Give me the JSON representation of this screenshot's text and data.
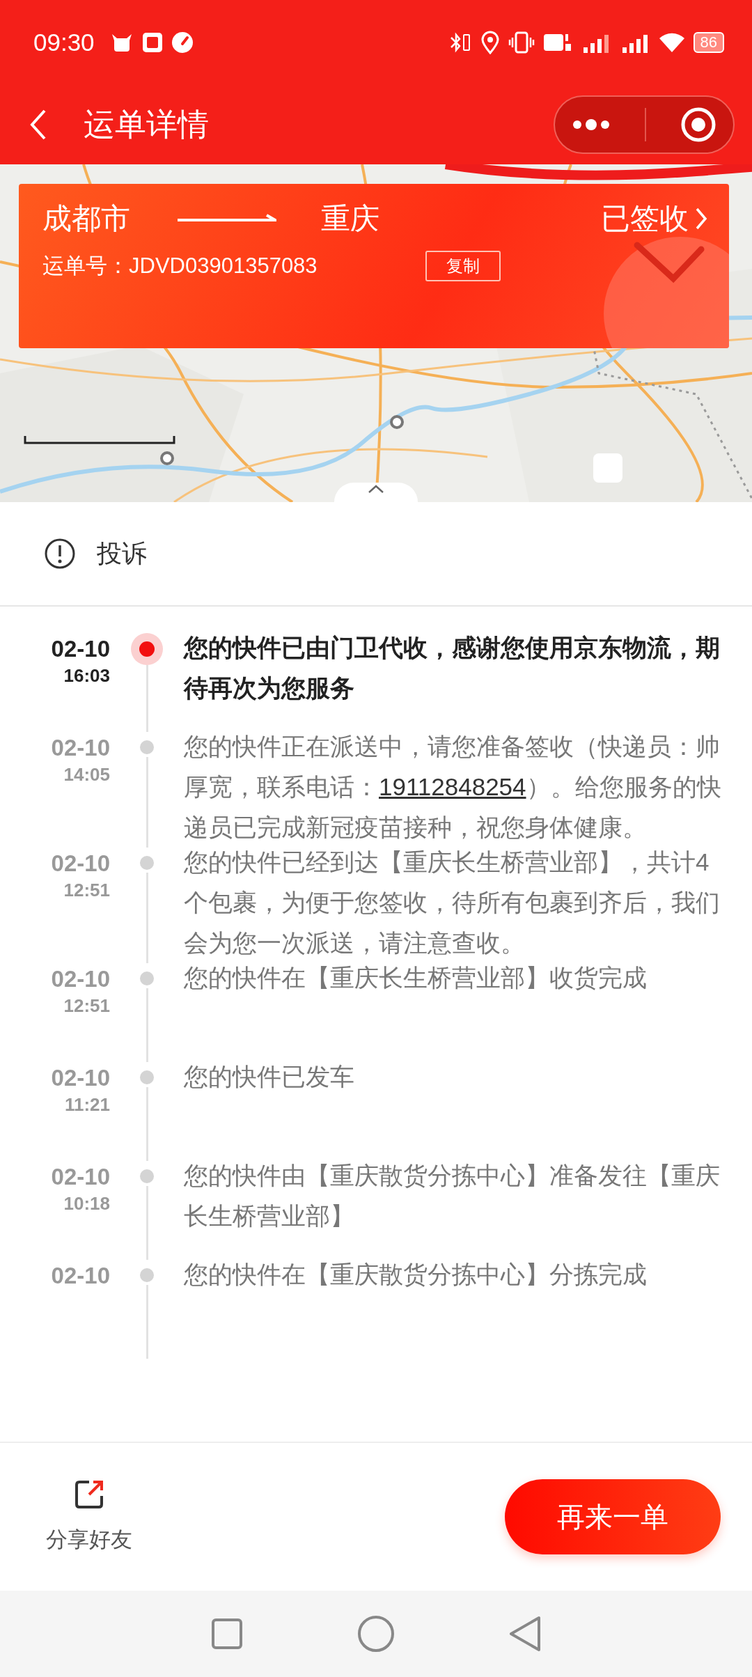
{
  "status_bar": {
    "time": "09:30",
    "battery": "86"
  },
  "header": {
    "title": "运单详情"
  },
  "shipment": {
    "origin": "成都市",
    "destination": "重庆",
    "status": "已签收",
    "waybill_label": "运单号：",
    "waybill_number": "JDVD03901357083",
    "copy_button": "复制"
  },
  "complaint": {
    "label": "投诉"
  },
  "timeline": [
    {
      "date": "02-10",
      "time": "16:03",
      "current": true,
      "parts": [
        {
          "kind": "text",
          "text": "您的快件已由门卫代收，感谢您使用京东物流，期待再次为您服务"
        }
      ]
    },
    {
      "date": "02-10",
      "time": "14:05",
      "current": false,
      "parts": [
        {
          "kind": "text",
          "text": "您的快件正在派送中，请您准备签收（快递员：帅厚宽，联系电话："
        },
        {
          "kind": "phone",
          "text": "19112848254"
        },
        {
          "kind": "text",
          "text": "）。给您服务的快递员已完成新冠疫苗接种，祝您身体健康。"
        }
      ]
    },
    {
      "date": "02-10",
      "time": "12:51",
      "current": false,
      "parts": [
        {
          "kind": "text",
          "text": "您的快件已经到达【重庆长生桥营业部】，共计4个包裹，为便于您签收，待所有包裹到齐后，我们会为您一次派送，请注意查收。"
        }
      ]
    },
    {
      "date": "02-10",
      "time": "12:51",
      "current": false,
      "parts": [
        {
          "kind": "text",
          "text": "您的快件在【重庆长生桥营业部】收货完成"
        }
      ]
    },
    {
      "date": "02-10",
      "time": "11:21",
      "current": false,
      "parts": [
        {
          "kind": "text",
          "text": "您的快件已发车"
        }
      ]
    },
    {
      "date": "02-10",
      "time": "10:18",
      "current": false,
      "parts": [
        {
          "kind": "text",
          "text": "您的快件由【重庆散货分拣中心】准备发往【重庆长生桥营业部】"
        }
      ]
    },
    {
      "date": "02-10",
      "current": false,
      "parts": [
        {
          "kind": "text",
          "text": "您的快件在【重庆散货分拣中心】分拣完成"
        }
      ]
    }
  ],
  "bottom_bar": {
    "share_label": "分享好友",
    "reorder_button": "再来一单"
  }
}
